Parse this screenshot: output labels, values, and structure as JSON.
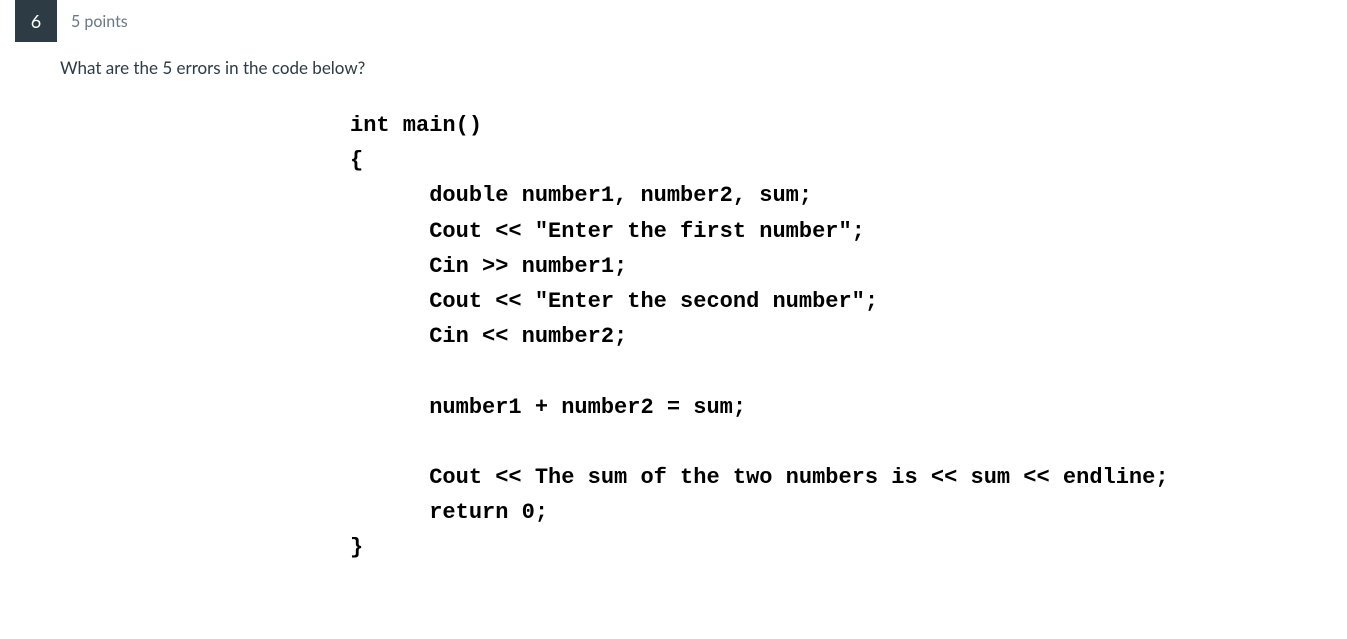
{
  "question": {
    "number": "6",
    "points": "5 points",
    "prompt": "What are the 5 errors in the code below?",
    "code": "int main()\n{\n      double number1, number2, sum;\n      Cout << \"Enter the first number\";\n      Cin >> number1;\n      Cout << \"Enter the second number\";\n      Cin << number2;\n\n      number1 + number2 = sum;\n\n      Cout << The sum of the two numbers is << sum << endline;\n      return 0;\n}"
  }
}
